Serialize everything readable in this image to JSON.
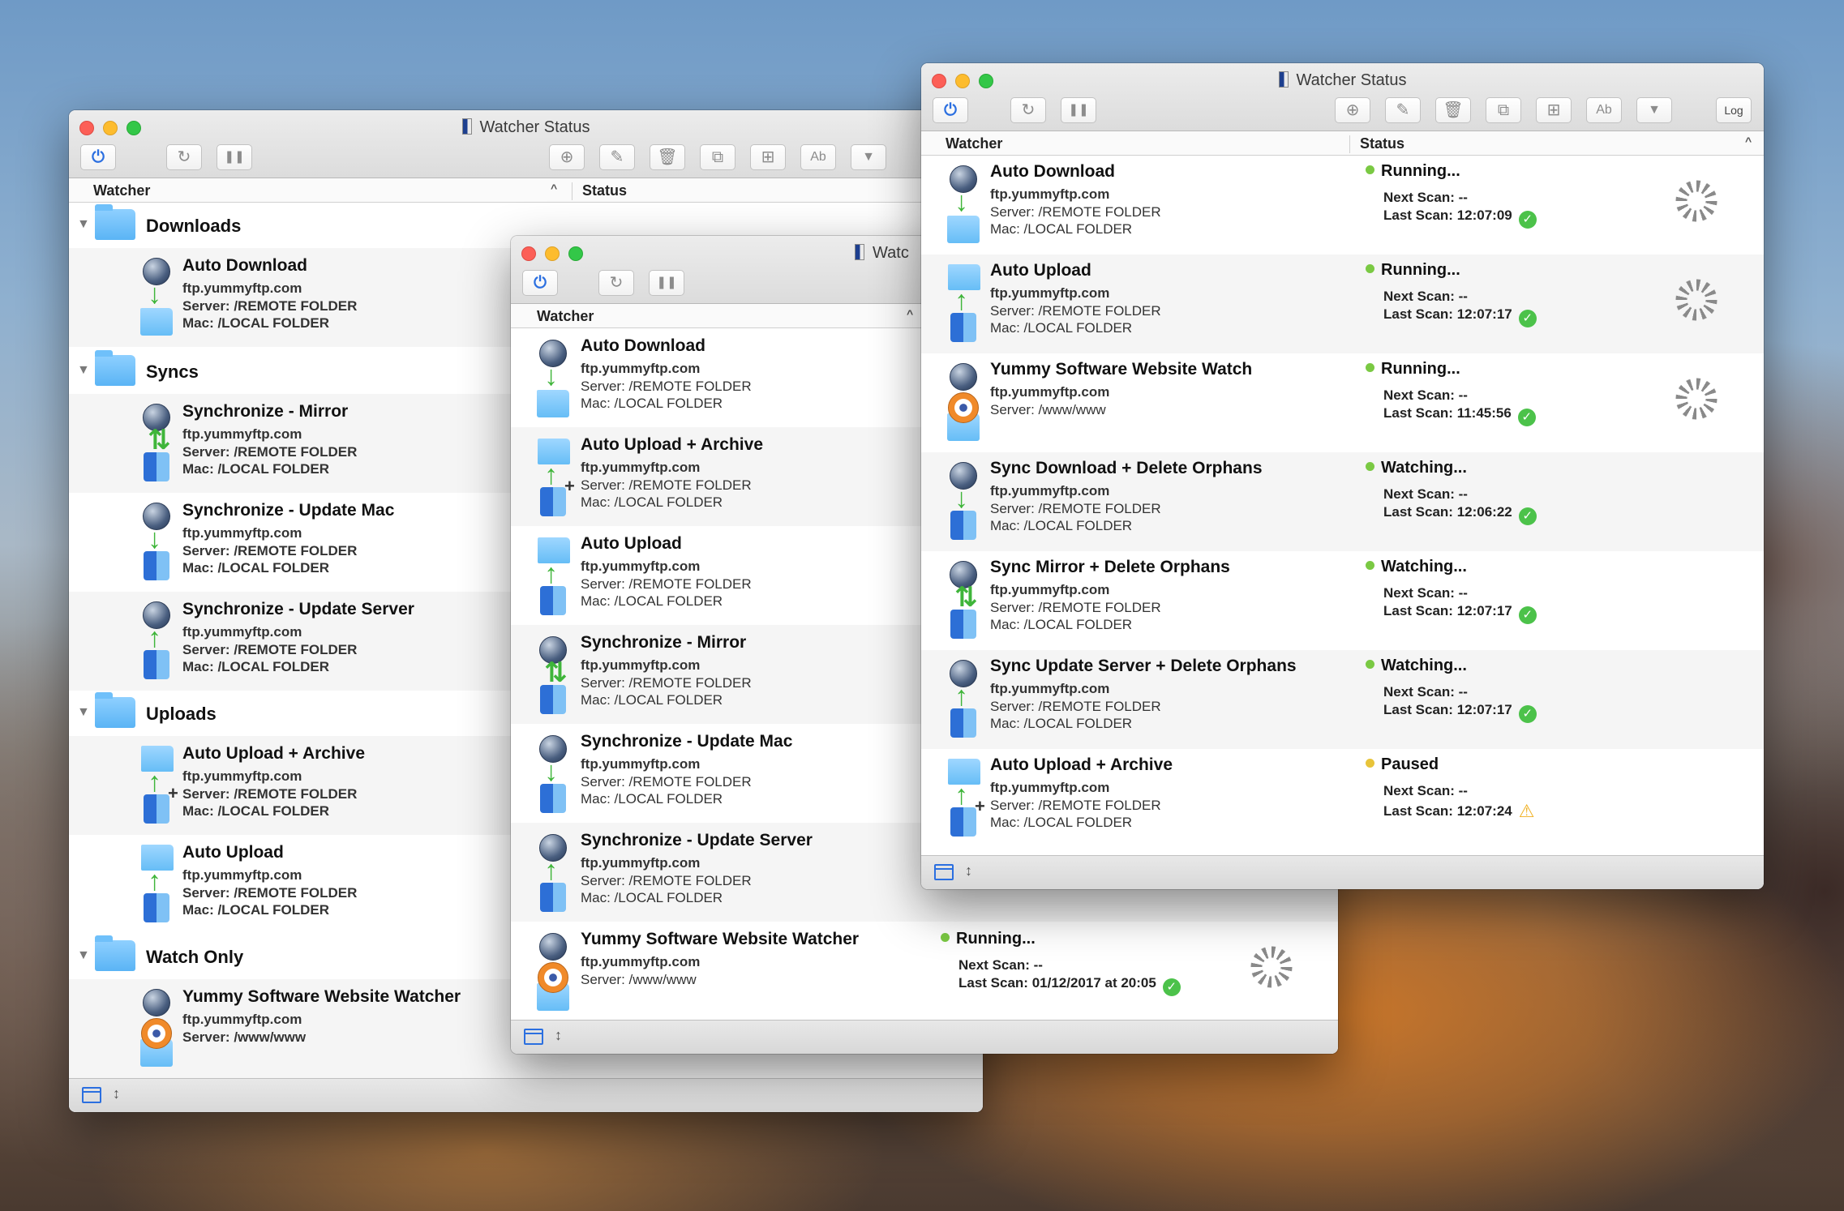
{
  "window_title": "Watcher Status",
  "mid_title": "Watc",
  "columns": {
    "watcher": "Watcher",
    "status": "Status"
  },
  "icons": {
    "power": "⏻",
    "refresh": "↻",
    "pause": "❚❚",
    "new_doc": "⊕",
    "edit": "✎",
    "delete": "🗑",
    "duplicate": "⧉",
    "new_folder": "⊞",
    "rename": "Ab",
    "filter": "▼",
    "log": "Log",
    "expanded": "▼",
    "sort_asc": "^",
    "sort": "↕",
    "check": "✓",
    "warning": "⚠"
  },
  "back": {
    "groups": {
      "downloads": "Downloads",
      "syncs": "Syncs",
      "uploads": "Uploads",
      "watch_only": "Watch Only"
    },
    "rows": [
      {
        "name": "Auto Download",
        "host": "ftp.yummyftp.com",
        "server": "Server: /REMOTE FOLDER",
        "mac": "Mac: /LOCAL FOLDER"
      },
      {
        "name": "Synchronize - Mirror",
        "host": "ftp.yummyftp.com",
        "server": "Server: /REMOTE FOLDER",
        "mac": "Mac: /LOCAL FOLDER"
      },
      {
        "name": "Synchronize - Update Mac",
        "host": "ftp.yummyftp.com",
        "server": "Server: /REMOTE FOLDER",
        "mac": "Mac: /LOCAL FOLDER"
      },
      {
        "name": "Synchronize - Update Server",
        "host": "ftp.yummyftp.com",
        "server": "Server: /REMOTE FOLDER",
        "mac": "Mac: /LOCAL FOLDER"
      },
      {
        "name": "Auto Upload + Archive",
        "host": "ftp.yummyftp.com",
        "server": "Server: /REMOTE FOLDER",
        "mac": "Mac: /LOCAL FOLDER"
      },
      {
        "name": "Auto Upload",
        "host": "ftp.yummyftp.com",
        "server": "Server: /REMOTE FOLDER",
        "mac": "Mac: /LOCAL FOLDER"
      },
      {
        "name": "Yummy Software Website Watcher",
        "host": "ftp.yummyftp.com",
        "server": "Server: /www/www"
      }
    ]
  },
  "mid": {
    "rows": [
      {
        "name": "Auto Download",
        "host": "ftp.yummyftp.com",
        "server": "Server: /REMOTE FOLDER",
        "mac": "Mac: /LOCAL FOLDER"
      },
      {
        "name": "Auto Upload + Archive",
        "host": "ftp.yummyftp.com",
        "server": "Server: /REMOTE FOLDER",
        "mac": "Mac: /LOCAL FOLDER"
      },
      {
        "name": "Auto Upload",
        "host": "ftp.yummyftp.com",
        "server": "Server: /REMOTE FOLDER",
        "mac": "Mac: /LOCAL FOLDER"
      },
      {
        "name": "Synchronize - Mirror",
        "host": "ftp.yummyftp.com",
        "server": "Server: /REMOTE FOLDER",
        "mac": "Mac: /LOCAL FOLDER"
      },
      {
        "name": "Synchronize - Update Mac",
        "host": "ftp.yummyftp.com",
        "server": "Server: /REMOTE FOLDER",
        "mac": "Mac: /LOCAL FOLDER"
      },
      {
        "name": "Synchronize - Update Server",
        "host": "ftp.yummyftp.com",
        "server": "Server: /REMOTE FOLDER",
        "mac": "Mac: /LOCAL FOLDER"
      },
      {
        "name": "Yummy Software Website Watcher",
        "host": "ftp.yummyftp.com",
        "server": "Server: /www/www",
        "status": "Running...",
        "next_scan": "Next Scan: --",
        "last_scan": "Last Scan: 01/12/2017 at 20:05"
      }
    ]
  },
  "front": {
    "rows": [
      {
        "name": "Auto Download",
        "host": "ftp.yummyftp.com",
        "server": "Server: /REMOTE FOLDER",
        "mac": "Mac: /LOCAL FOLDER",
        "status": "Running...",
        "next_scan": "Next Scan: --",
        "last_scan": "Last Scan: 12:07:09"
      },
      {
        "name": "Auto Upload",
        "host": "ftp.yummyftp.com",
        "server": "Server: /REMOTE FOLDER",
        "mac": "Mac: /LOCAL FOLDER",
        "status": "Running...",
        "next_scan": "Next Scan: --",
        "last_scan": "Last Scan: 12:07:17"
      },
      {
        "name": "Yummy Software Website Watch",
        "host": "ftp.yummyftp.com",
        "server": "Server: /www/www",
        "status": "Running...",
        "next_scan": "Next Scan: --",
        "last_scan": "Last Scan: 11:45:56"
      },
      {
        "name": "Sync Download + Delete Orphans",
        "host": "ftp.yummyftp.com",
        "server": "Server: /REMOTE FOLDER",
        "mac": "Mac: /LOCAL FOLDER",
        "status": "Watching...",
        "next_scan": "Next Scan: --",
        "last_scan": "Last Scan: 12:06:22"
      },
      {
        "name": "Sync Mirror + Delete Orphans",
        "host": "ftp.yummyftp.com",
        "server": "Server: /REMOTE FOLDER",
        "mac": "Mac: /LOCAL FOLDER",
        "status": "Watching...",
        "next_scan": "Next Scan: --",
        "last_scan": "Last Scan: 12:07:17"
      },
      {
        "name": "Sync Update Server + Delete Orphans",
        "host": "ftp.yummyftp.com",
        "server": "Server: /REMOTE FOLDER",
        "mac": "Mac: /LOCAL FOLDER",
        "status": "Watching...",
        "next_scan": "Next Scan: --",
        "last_scan": "Last Scan: 12:07:17"
      },
      {
        "name": "Auto Upload + Archive",
        "host": "ftp.yummyftp.com",
        "server": "Server: /REMOTE FOLDER",
        "mac": "Mac: /LOCAL FOLDER",
        "status": "Paused",
        "next_scan": "Next Scan: --",
        "last_scan": "Last Scan: 12:07:24"
      }
    ]
  },
  "colors": {
    "running": "#7ac943",
    "paused": "#e8c43a",
    "accent": "#2b6fe0"
  }
}
